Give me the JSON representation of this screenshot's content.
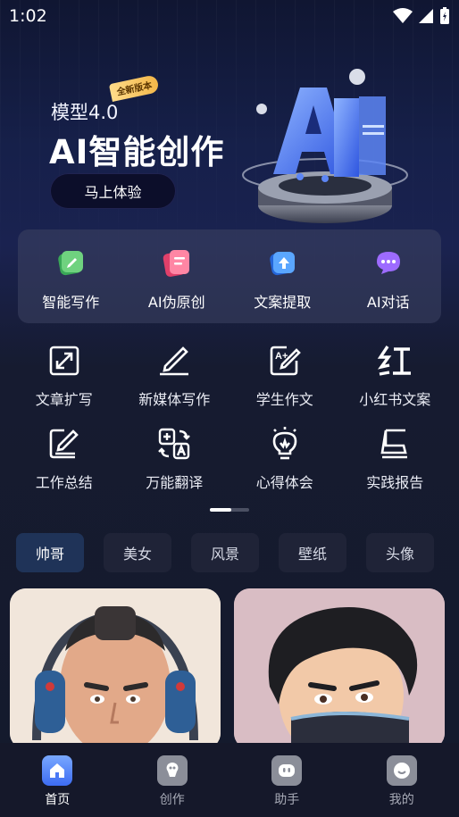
{
  "status_bar": {
    "time": "1:02",
    "icons": [
      "wifi-icon",
      "signal-icon",
      "battery-icon"
    ]
  },
  "hero": {
    "model_label": "模型4.0",
    "badge": "全新版本",
    "title": "AI智能创作",
    "cta_label": "马上体验",
    "art_text": "AI"
  },
  "features": [
    {
      "label": "智能写作",
      "icon": "green-pen-icon",
      "color": "#4cc267"
    },
    {
      "label": "AI伪原创",
      "icon": "pink-doc-icon",
      "color": "#f0577f"
    },
    {
      "label": "文案提取",
      "icon": "blue-upload-icon",
      "color": "#3f8df5"
    },
    {
      "label": "AI对话",
      "icon": "purple-chat-icon",
      "color": "#8b5cf0"
    }
  ],
  "tools": [
    {
      "label": "文章扩写",
      "icon": "expand-icon"
    },
    {
      "label": "新媒体写作",
      "icon": "pen-writing-icon"
    },
    {
      "label": "学生作文",
      "icon": "essay-edit-icon"
    },
    {
      "label": "小红书文案",
      "icon": "hong-character-icon"
    },
    {
      "label": "工作总结",
      "icon": "summary-edit-icon"
    },
    {
      "label": "万能翻译",
      "icon": "translate-icon"
    },
    {
      "label": "心得体会",
      "icon": "lightbulb-icon"
    },
    {
      "label": "实践报告",
      "icon": "report-icon"
    }
  ],
  "categories": [
    {
      "label": "帅哥",
      "active": true
    },
    {
      "label": "美女",
      "active": false
    },
    {
      "label": "风景",
      "active": false
    },
    {
      "label": "壁纸",
      "active": false
    },
    {
      "label": "头像",
      "active": false
    }
  ],
  "gallery": [
    {
      "name": "headphone-guy-avatar",
      "bg": "#f1e6db"
    },
    {
      "name": "masked-guy-avatar",
      "bg": "#d9bdc4"
    }
  ],
  "nav": [
    {
      "label": "首页",
      "icon": "home-icon",
      "active": true
    },
    {
      "label": "创作",
      "icon": "create-icon",
      "active": false
    },
    {
      "label": "助手",
      "icon": "assistant-icon",
      "active": false
    },
    {
      "label": "我的",
      "icon": "profile-icon",
      "active": false
    }
  ]
}
